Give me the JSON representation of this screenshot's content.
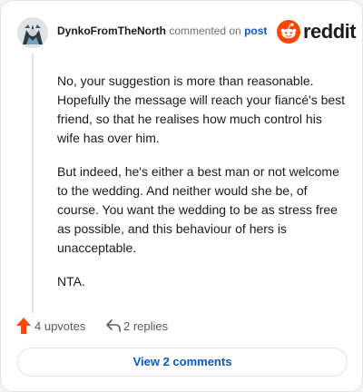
{
  "header": {
    "username": "DynkoFromTheNorth",
    "action_text": "commented on",
    "post_link": "post"
  },
  "brand": {
    "name": "reddit",
    "icon": "reddit-snoo-icon",
    "color": "#ff4500"
  },
  "comment": {
    "paragraphs": [
      "No, your suggestion is more than reasonable. Hopefully the message will reach your fiancé's best friend, so that he realises how much control his wife has over him.",
      "But indeed, he's either a best man or not welcome to the wedding. And neither would she be, of course. You want the wedding to be as stress free as possible, and this behaviour of hers is unacceptable.",
      "NTA."
    ]
  },
  "actions": {
    "upvotes": "4 upvotes",
    "upvote_icon": "upvote-arrow-icon",
    "replies": "2 replies",
    "reply_icon": "reply-arrow-icon"
  },
  "footer": {
    "view_comments": "View 2 comments"
  },
  "colors": {
    "accent": "#0a58ca",
    "upvote": "#ff4500",
    "muted": "#575b5e"
  }
}
